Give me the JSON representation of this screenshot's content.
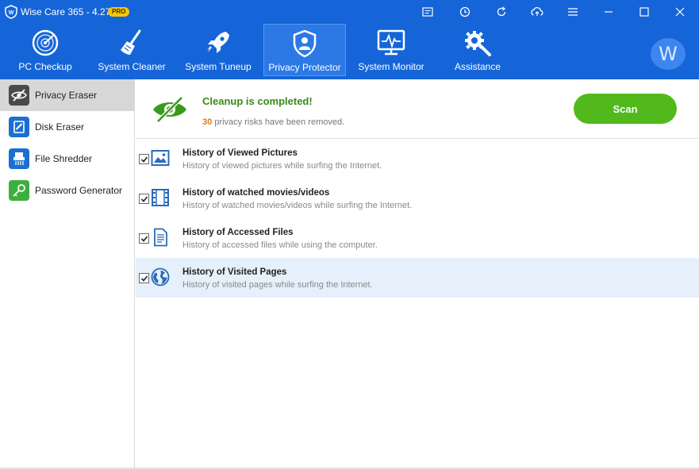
{
  "window": {
    "title": "Wise Care 365 - 4.27",
    "badge": "PRO"
  },
  "titlebar_buttons": [
    {
      "name": "feedback-icon"
    },
    {
      "name": "restore-point-icon"
    },
    {
      "name": "refresh-icon"
    },
    {
      "name": "cloud-icon"
    },
    {
      "name": "menu-icon"
    },
    {
      "name": "minimize-icon"
    },
    {
      "name": "maximize-icon"
    },
    {
      "name": "close-icon"
    }
  ],
  "nav": {
    "items": [
      {
        "label": "PC Checkup",
        "icon": "radar-icon"
      },
      {
        "label": "System Cleaner",
        "icon": "broom-icon"
      },
      {
        "label": "System Tuneup",
        "icon": "rocket-icon"
      },
      {
        "label": "Privacy Protector",
        "icon": "shield-user-icon",
        "active": true
      },
      {
        "label": "System Monitor",
        "icon": "monitor-pulse-icon"
      },
      {
        "label": "Assistance",
        "icon": "gears-icon"
      }
    ],
    "avatar_letter": "W"
  },
  "sidebar": {
    "items": [
      {
        "label": "Privacy Eraser",
        "icon": "eye-slash-icon",
        "active": true
      },
      {
        "label": "Disk Eraser",
        "icon": "disk-eraser-icon"
      },
      {
        "label": "File Shredder",
        "icon": "shredder-icon"
      },
      {
        "label": "Password Generator",
        "icon": "key-icon"
      }
    ]
  },
  "status": {
    "title": "Cleanup is completed!",
    "count": "30",
    "message": "privacy risks have been removed.",
    "scan_label": "Scan"
  },
  "items": [
    {
      "title": "History of Viewed Pictures",
      "desc": "History of viewed pictures while surfing the Internet.",
      "checked": true,
      "icon": "picture-icon"
    },
    {
      "title": "History of watched movies/videos",
      "desc": "History of watched movies/videos while surfing the Internet.",
      "checked": true,
      "icon": "film-icon"
    },
    {
      "title": "History of Accessed Files",
      "desc": "History of accessed files while using the computer.",
      "checked": true,
      "icon": "document-icon"
    },
    {
      "title": "History of Visited Pages",
      "desc": "History of visited pages while surfing the Internet.",
      "checked": true,
      "icon": "globe-icon"
    }
  ],
  "colors": {
    "header": "#1565d8",
    "success": "#3a8a14",
    "scan_button": "#52b91c",
    "count": "#e07a10",
    "row_highlight": "#e5f0fb"
  }
}
